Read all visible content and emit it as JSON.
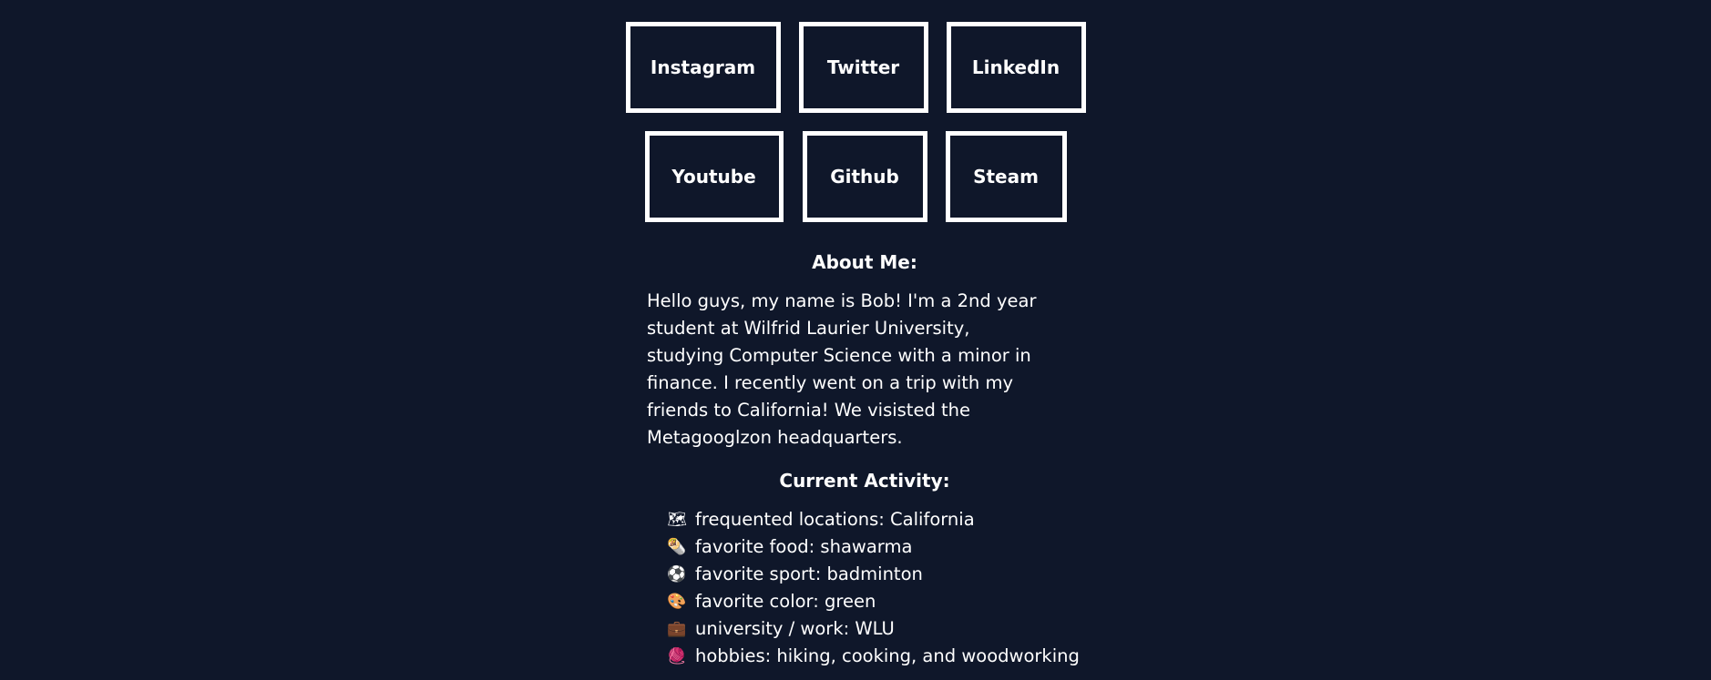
{
  "social": {
    "row1": [
      "Instagram",
      "Twitter",
      "LinkedIn"
    ],
    "row2": [
      "Youtube",
      "Github",
      "Steam"
    ]
  },
  "about": {
    "heading": "About Me:",
    "text": "Hello guys, my name is Bob! I'm a 2nd year student at Wilfrid Laurier University, studying Computer Science with a minor in finance. I recently went on a trip with my friends to California! We visisted the Metagooglzon headquarters."
  },
  "activity": {
    "heading": "Current Activity:",
    "items": [
      {
        "icon": "map-icon",
        "glyph": "🗺",
        "text": "frequented locations: California"
      },
      {
        "icon": "food-icon",
        "glyph": "🌯",
        "text": "favorite food: shawarma"
      },
      {
        "icon": "ball-icon",
        "glyph": "⚽",
        "text": "favorite sport: badminton"
      },
      {
        "icon": "palette-icon",
        "glyph": "🎨",
        "text": "favorite color: green"
      },
      {
        "icon": "briefcase-icon",
        "glyph": "💼",
        "text": "university / work: WLU"
      },
      {
        "icon": "yarn-icon",
        "glyph": "🧶",
        "text": "hobbies: hiking, cooking, and woodworking"
      }
    ]
  },
  "colors": {
    "background": "#0f172a",
    "text": "#ffffff",
    "border": "#ffffff"
  }
}
